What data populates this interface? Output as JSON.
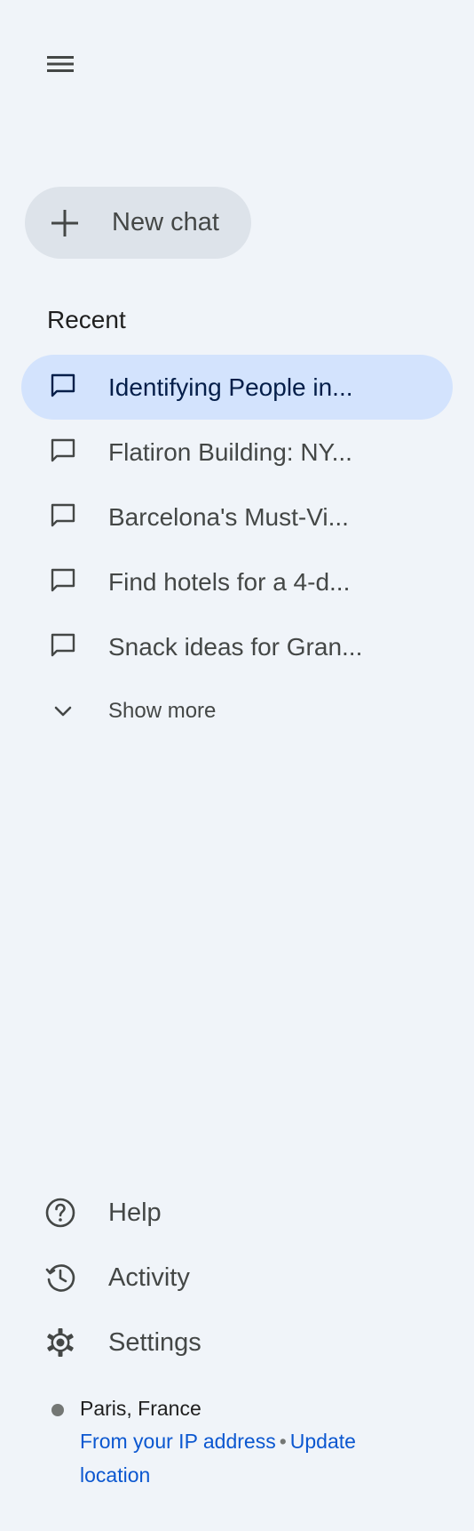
{
  "sidebar": {
    "menu_icon": "hamburger-menu-icon",
    "new_chat_label": "New chat",
    "recent_title": "Recent",
    "recent_chats": [
      {
        "label": "Identifying People in...",
        "active": true
      },
      {
        "label": "Flatiron Building: NY...",
        "active": false
      },
      {
        "label": "Barcelona's Must-Vi...",
        "active": false
      },
      {
        "label": "Find hotels for a 4-d...",
        "active": false
      },
      {
        "label": "Snack ideas for Gran...",
        "active": false
      }
    ],
    "show_more_label": "Show more",
    "bottom_items": [
      {
        "label": "Help",
        "icon": "help-icon"
      },
      {
        "label": "Activity",
        "icon": "history-icon"
      },
      {
        "label": "Settings",
        "icon": "gear-icon"
      }
    ],
    "location": {
      "place": "Paris, France",
      "ip_link": "From your IP address",
      "separator": "•",
      "update_link": "Update location"
    }
  },
  "colors": {
    "background": "#f0f4f9",
    "new_chat_bg": "#dde3ea",
    "active_item_bg": "#d3e3fd",
    "link": "#0b57d0"
  }
}
